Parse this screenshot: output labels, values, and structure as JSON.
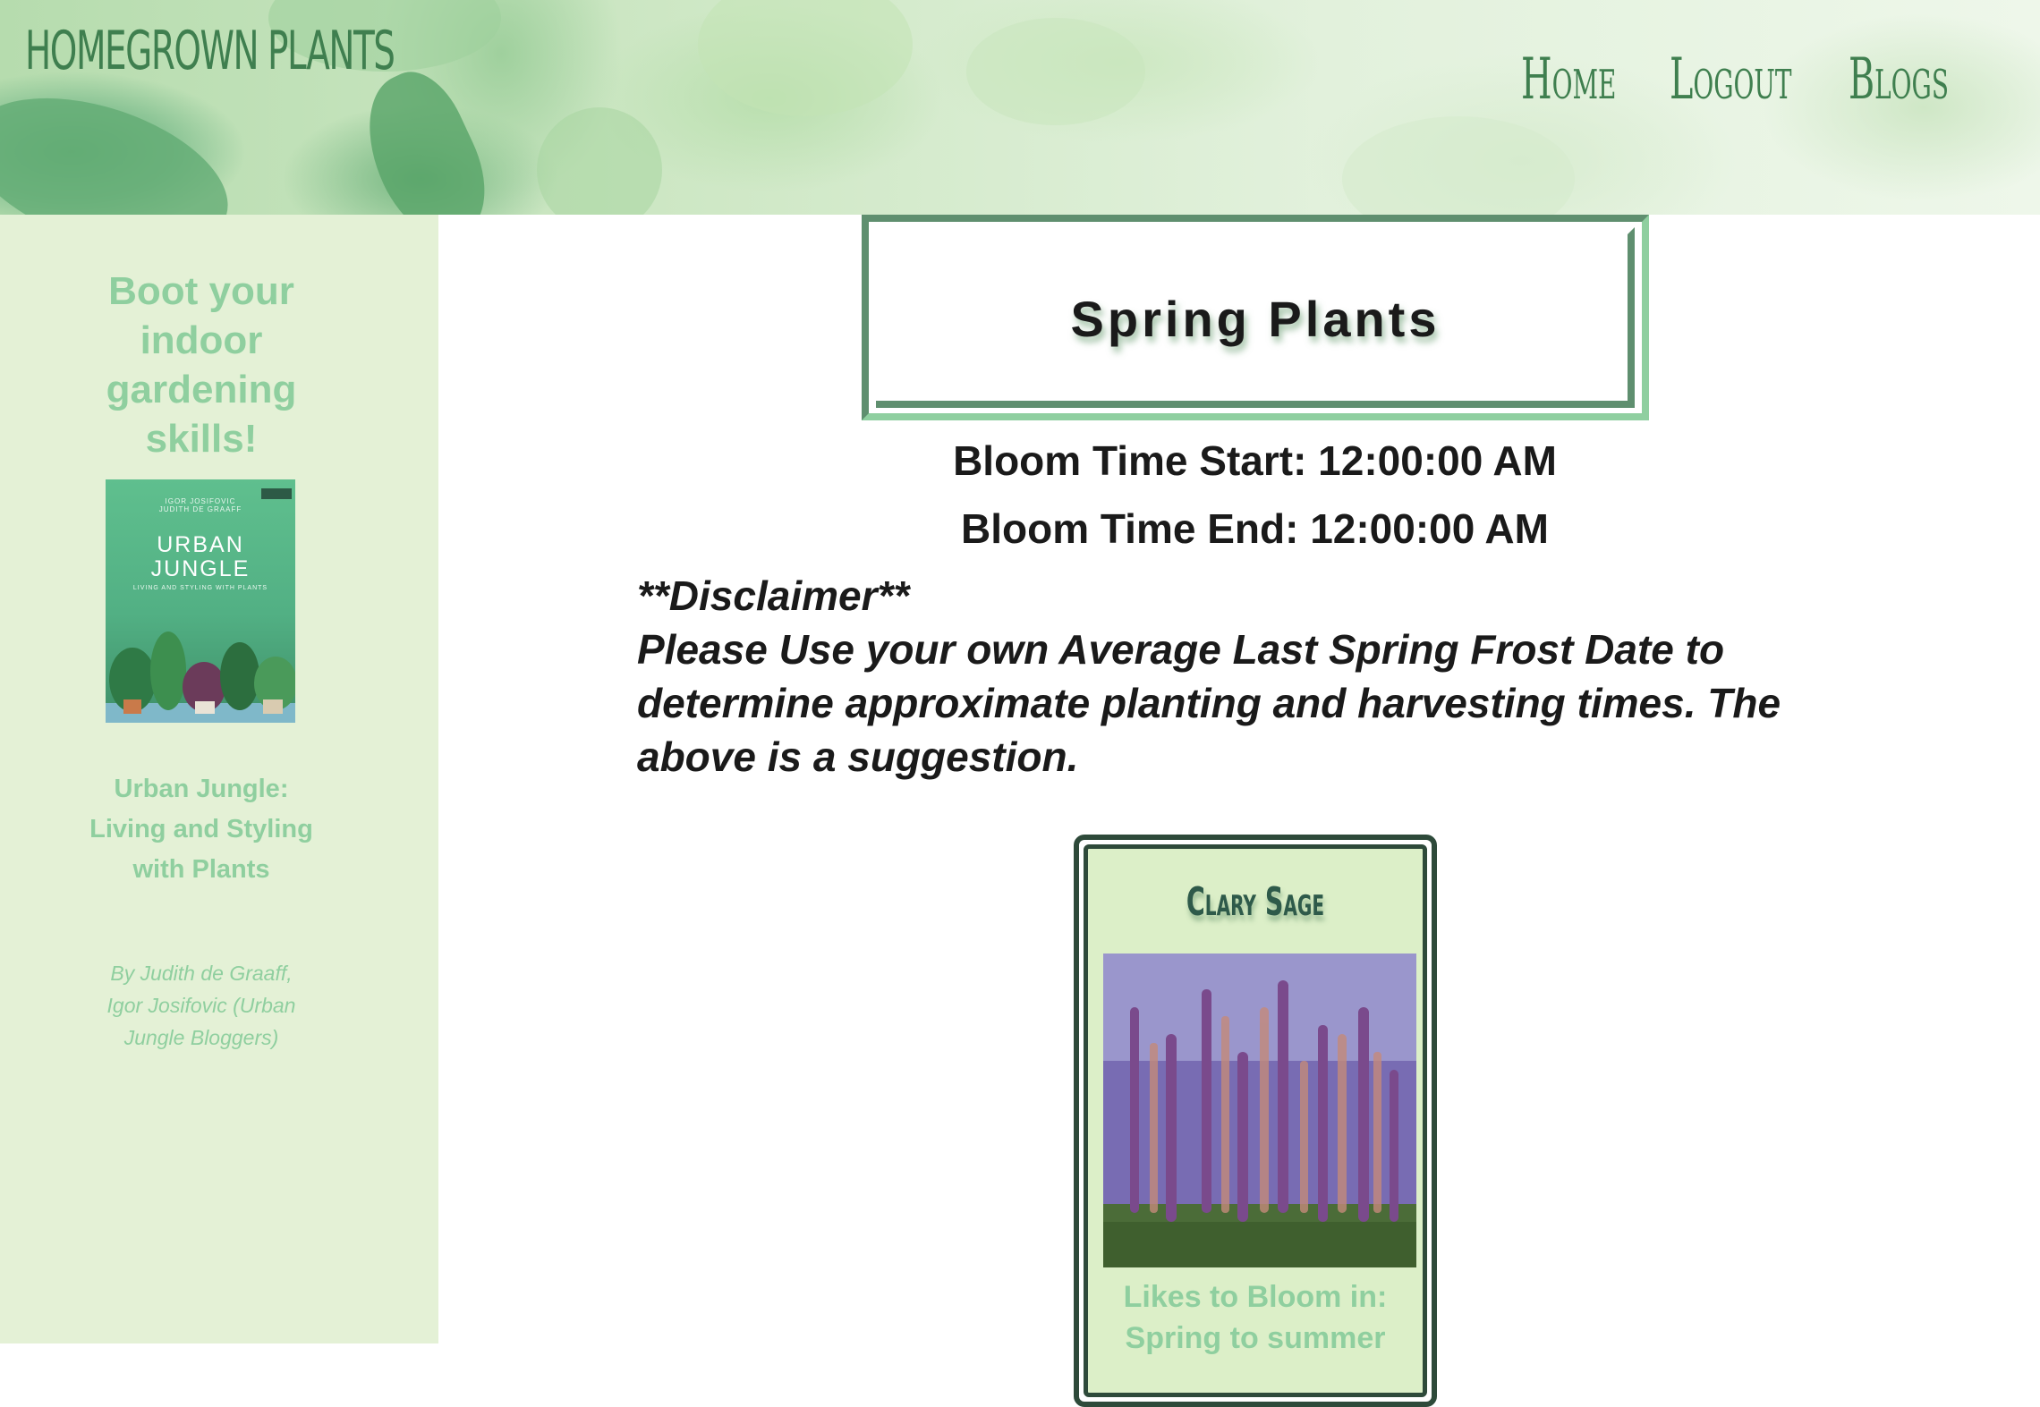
{
  "header": {
    "site_title": "HOMEGROWN PLANTS",
    "nav": [
      "Home",
      "Logout",
      "Blogs"
    ]
  },
  "sidebar": {
    "promo_heading": "Boot your indoor gardening skills!",
    "book": {
      "cover_authors": "IGOR JOSIFOVIC\nJUDITH DE GRAAFF",
      "cover_publisher": "CALLWEY",
      "cover_title": "URBAN JUNGLE",
      "cover_subtitle": "LIVING AND STYLING WITH PLANTS",
      "title": "Urban Jungle: Living and Styling with Plants",
      "byline": "By Judith de Graaff, Igor Josifovic (Urban Jungle Bloggers)"
    }
  },
  "main": {
    "page_title": "Spring Plants",
    "bloom_start": "Bloom Time Start: 12:00:00 AM",
    "bloom_end": "Bloom Time End: 12:00:00 AM",
    "disclaimer_heading": "**Disclaimer**",
    "disclaimer_text": "Please Use your own Average Last Spring Frost Date to determine approximate planting and harvesting times. The above is a suggestion."
  },
  "plants": [
    {
      "name": "Clary Sage",
      "bloom_label": "Likes to Bloom in:",
      "bloom_value": "Spring to summer"
    }
  ],
  "colors": {
    "brand_green": "#3f7f4f",
    "sidebar_bg": "#e4f1d6",
    "accent_mint": "#8fcf9f",
    "card_bg": "#dcefc8",
    "frame_dark": "#5f8f6f"
  }
}
